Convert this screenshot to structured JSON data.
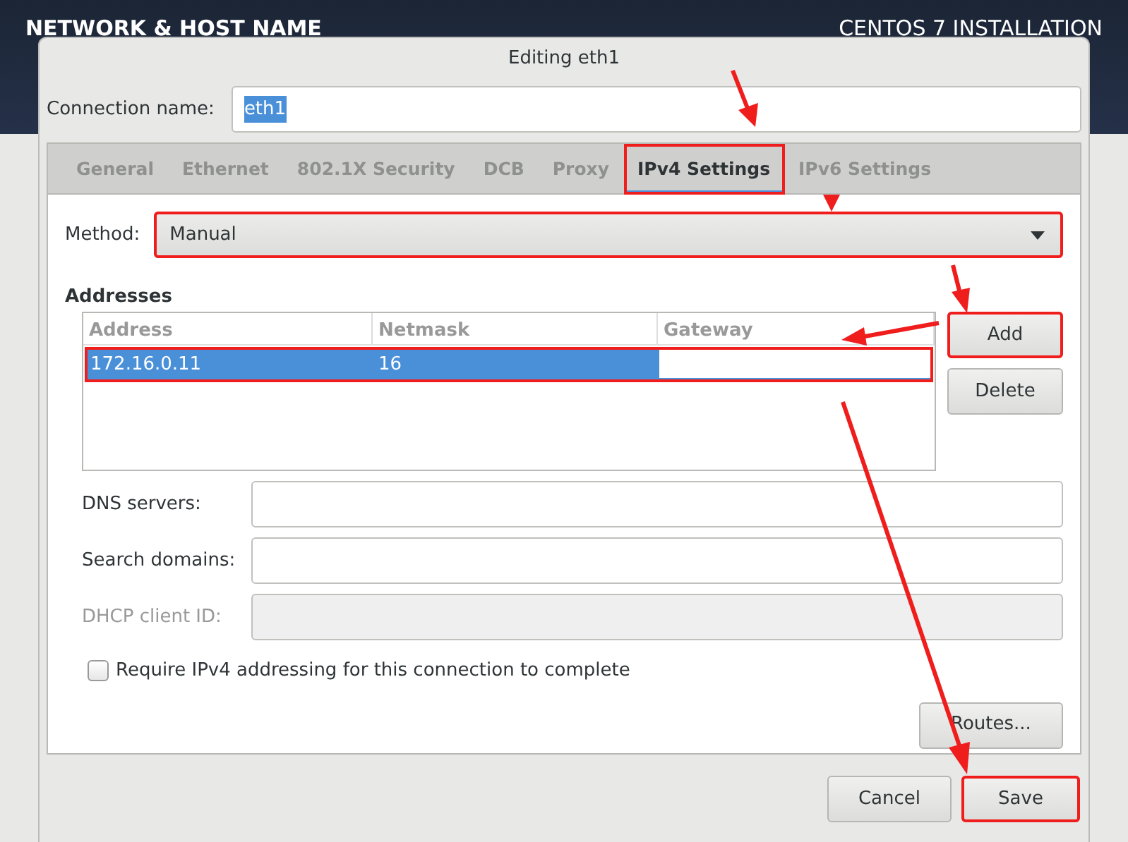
{
  "background": {
    "title": "NETWORK & HOST NAME",
    "product": "CENTOS 7 INSTALLATION"
  },
  "dialog": {
    "title": "Editing eth1",
    "connection_label": "Connection name:",
    "connection_name": "eth1",
    "connection_name_selected": true
  },
  "tabs": [
    {
      "label": "General",
      "selected": false,
      "highlighted": false
    },
    {
      "label": "Ethernet",
      "selected": false,
      "highlighted": false
    },
    {
      "label": "802.1X Security",
      "selected": false,
      "highlighted": false
    },
    {
      "label": "DCB",
      "selected": false,
      "highlighted": false
    },
    {
      "label": "Proxy",
      "selected": false,
      "highlighted": false
    },
    {
      "label": "IPv4 Settings",
      "selected": true,
      "highlighted": true
    },
    {
      "label": "IPv6 Settings",
      "selected": false,
      "highlighted": false
    }
  ],
  "method": {
    "label": "Method:",
    "value": "Manual",
    "highlighted": true
  },
  "addresses": {
    "title": "Addresses",
    "columns": [
      "Address",
      "Netmask",
      "Gateway"
    ],
    "rows": [
      {
        "address": "172.16.0.11",
        "netmask": "16",
        "selected": true,
        "gateway_editing": true,
        "highlighted": true
      }
    ],
    "buttons": [
      {
        "label": "Add",
        "highlighted": true
      },
      {
        "label": "Delete",
        "highlighted": false
      }
    ]
  },
  "fields": [
    {
      "label": "DNS servers:",
      "disabled": false
    },
    {
      "label": "Search domains:",
      "disabled": false
    },
    {
      "label": "DHCP client ID:",
      "disabled": true
    }
  ],
  "require_checkbox": {
    "label": "Require IPv4 addressing for this connection to complete",
    "checked": false
  },
  "routes_button": "Routes...",
  "footer_buttons": [
    {
      "label": "Cancel",
      "highlighted": false
    },
    {
      "label": "Save",
      "highlighted": true
    }
  ]
}
